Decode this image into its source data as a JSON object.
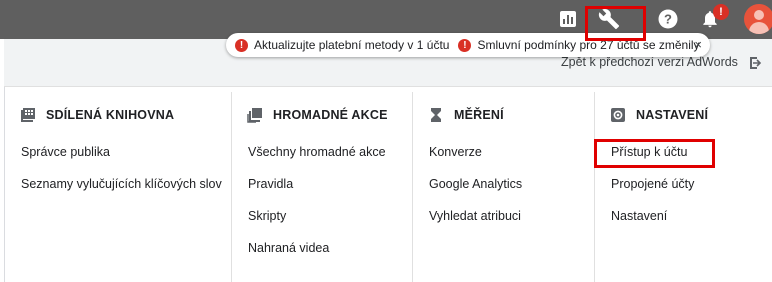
{
  "topbar": {
    "icons": [
      "bar-chart-icon",
      "wrench-icon",
      "help-icon",
      "bell-icon",
      "avatar"
    ],
    "bell_badge": "!"
  },
  "notifications": {
    "items": [
      {
        "text": "Aktualizujte platební metody v 1 účtu",
        "icon": "!"
      },
      {
        "text": "Smluvní podmínky pro 27 účtů se změnily",
        "icon": "!"
      }
    ],
    "close": "×"
  },
  "back_link": "Zpět k předchozí verzi AdWords",
  "columns": [
    {
      "heading": "SDÍLENÁ KNIHOVNA",
      "icon": "library-icon",
      "items": [
        "Správce publika",
        "Seznamy vylučujících klíčových slov"
      ]
    },
    {
      "heading": "HROMADNÉ AKCE",
      "icon": "bulk-actions-icon",
      "items": [
        "Všechny hromadné akce",
        "Pravidla",
        "Skripty",
        "Nahraná videa"
      ]
    },
    {
      "heading": "MĚŘENÍ",
      "icon": "hourglass-icon",
      "items": [
        "Konverze",
        "Google Analytics",
        "Vyhledat atribuci"
      ]
    },
    {
      "heading": "NASTAVENÍ",
      "icon": "settings-icon",
      "items": [
        "Přístup k účtu",
        "Propojené účty",
        "Nastavení"
      ]
    }
  ],
  "colors": {
    "topbar": "#5f5f5f",
    "highlight": "#e00000",
    "error": "#d93025"
  }
}
